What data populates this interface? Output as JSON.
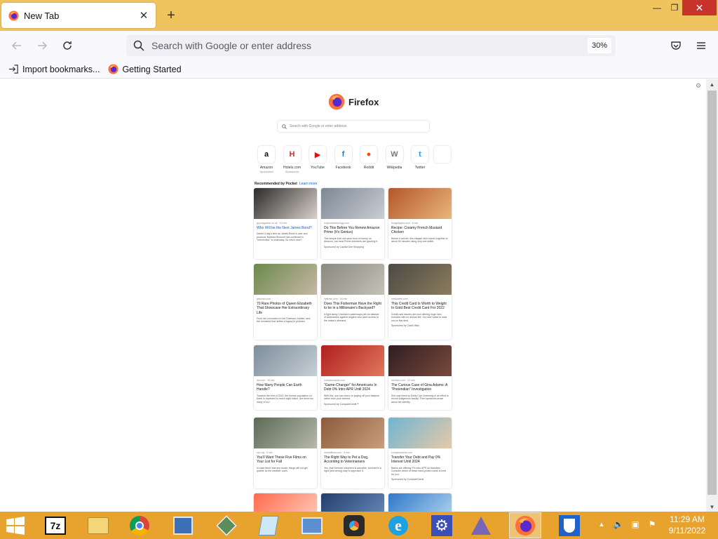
{
  "tab": {
    "title": "New Tab",
    "close": "✕",
    "new": "+"
  },
  "window": {
    "minimize": "—",
    "restore": "❐",
    "close": "✕"
  },
  "urlbar": {
    "placeholder": "Search with Google or enter address",
    "zoom": "30%"
  },
  "bookmarks": [
    {
      "label": "Import bookmarks...",
      "icon": "import-icon"
    },
    {
      "label": "Getting Started",
      "icon": "firefox-icon"
    }
  ],
  "newtab": {
    "brand": "Firefox",
    "search_placeholder": "Search with Google or enter address",
    "topsites": [
      {
        "label": "Amazon",
        "sub": "Sponsored",
        "glyph": "a",
        "color": "#111111"
      },
      {
        "label": "Hotels.com",
        "sub": "Sponsored",
        "glyph": "H",
        "color": "#d32f2f"
      },
      {
        "label": "YouTube",
        "sub": "",
        "glyph": "▶",
        "color": "#ff0000"
      },
      {
        "label": "Facebook",
        "sub": "",
        "glyph": "f",
        "color": "#1877f2"
      },
      {
        "label": "Reddit",
        "sub": "",
        "glyph": "●",
        "color": "#ff4500"
      },
      {
        "label": "Wikipedia",
        "sub": "",
        "glyph": "W",
        "color": "#777777"
      },
      {
        "label": "Twitter",
        "sub": "",
        "glyph": "t",
        "color": "#1da1f2"
      }
    ],
    "pocket_heading": "Recommended by Pocket",
    "pocket_learn": "Learn more",
    "cards": [
      {
        "src": "gq-magazine.co.uk · 10 min",
        "title": "Who Will be the Next James Bond?",
        "blue": true,
        "excerpt": "Daniel Craig's time as James Bond is over and producer Barbara Broccoli has confirmed a \"reinvention\" is underway. So who's next?",
        "spon": ""
      },
      {
        "src": "exploretechnology.com",
        "title": "Do This Before You Renew Amazon Prime (It's Genius)",
        "blue": false,
        "excerpt": "This simple trick can save tons of money on Amazon, but most Prime members are ignoring it.",
        "spon": "Sponsored by Capital One Shopping"
      },
      {
        "src": "budgetbytes.com · 6 min",
        "title": "Recipe: Creamy French Mustard Chicken",
        "blue": false,
        "excerpt": "Before it arrives, this elegant dish comes together in about 30 minutes using only one skillet.",
        "spon": ""
      },
      {
        "src": "glamour.com",
        "title": "70 Rare Photos of Queen Elizabeth That Showcase Her Extraordinary Life",
        "blue": false,
        "excerpt": "From her coronation to her Diamond Jubilee, and the moments that define a legacy in pictures.",
        "spon": ""
      },
      {
        "src": "nytimes.com · 18 min",
        "title": "Does This Fisherman Have the Right to be in a Millionaire's Backyard?",
        "blue": false,
        "excerpt": "A fight along Colorado's waterways pits an alliance of landowners against anglers who want access to the nation's streams.",
        "spon": ""
      },
      {
        "src": "nerdwallet.com",
        "title": "This Credit Card Is Worth to Weight In Gold Best Credit Card For 2022",
        "blue": false,
        "excerpt": "Credit card issuers are now offering huge intro bonuses with no annual fee. You don't want to miss out on this deal.",
        "spon": "Sponsored by CardCritics"
      },
      {
        "src": "dw.com · 18 min",
        "title": "How Many People Can Earth Handle?",
        "blue": false,
        "excerpt": "Towards the end of 2022, the human population on Earth is expected to reach eight billion. Are there too many of us?",
        "spon": ""
      },
      {
        "src": "comparecards.com",
        "title": "\"Game-Changer\" for Americans In Debt 0% Intro APR Until 2024",
        "blue": false,
        "excerpt": "With this, you can focus on paying off your balance rather than your interest.",
        "spon": "Sponsored by CompareCredit™"
      },
      {
        "src": "medium.com · 22 min",
        "title": "The Curious Case of Gina Adams: A \"Pretendian\" Investigation",
        "blue": false,
        "excerpt": "She was hired by Emily Carr University in an effort to recruit Indigenous faculty. Then questions arose about her identity.",
        "spon": ""
      },
      {
        "src": "npr.org · 5 min",
        "title": "You'll Want These Five Films on Your List for Fall",
        "blue": false,
        "excerpt": "In case there was any doubt, things will not get quieter as the weather cools.",
        "spon": ""
      },
      {
        "src": "mentalfloss.com · 6 min",
        "title": "The Right Way to Pet a Dog, According to Veterinarians",
        "blue": false,
        "excerpt": "Yes, that German shepherd is adorable, but there's a right (and wrong) way to approach it.",
        "spon": ""
      },
      {
        "src": "comparecards.com",
        "title": "Transfer Your Debt and Pay 0% Interest Until 2024",
        "blue": false,
        "excerpt": "Banks are offering 0% intro APR on transfers. Consider which of these hand-picked cards is best for you.",
        "spon": "Sponsored by CompareCards"
      }
    ]
  },
  "taskbar": {
    "items": [
      "7-zip",
      "file-explorer",
      "chrome",
      "network-settings",
      "install-manager",
      "notepad",
      "control-panel",
      "davinci-resolve",
      "internet-explorer",
      "settings",
      "alpha-app",
      "firefox",
      "defender"
    ],
    "time": "11:29 AM",
    "date": "9/11/2022"
  }
}
